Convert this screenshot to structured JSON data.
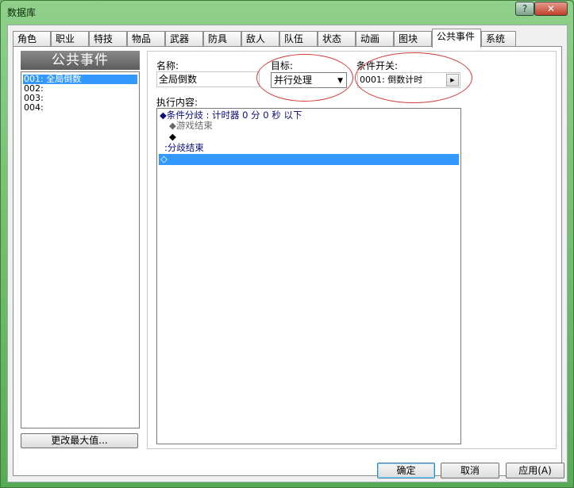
{
  "window": {
    "title": "数据库",
    "help_label": "?",
    "close_label": "✕"
  },
  "tabs": [
    {
      "label": "角色"
    },
    {
      "label": "职业"
    },
    {
      "label": "特技"
    },
    {
      "label": "物品"
    },
    {
      "label": "武器"
    },
    {
      "label": "防具"
    },
    {
      "label": "敌人"
    },
    {
      "label": "队伍"
    },
    {
      "label": "状态"
    },
    {
      "label": "动画"
    },
    {
      "label": "图块"
    },
    {
      "label": "公共事件"
    },
    {
      "label": "系统"
    }
  ],
  "active_tab": "公共事件",
  "sidebar": {
    "header": "公共事件",
    "items": [
      {
        "label": "001: 全局倒数"
      },
      {
        "label": "002:"
      },
      {
        "label": "003:"
      },
      {
        "label": "004:"
      }
    ],
    "change_max_label": "更改最大值..."
  },
  "form": {
    "name_label": "名称:",
    "name_value": "全局倒数",
    "target_label": "目标:",
    "target_value": "并行处理",
    "switch_label": "条件开关:",
    "switch_value": "0001: 倒数计时",
    "content_label": "执行内容:"
  },
  "commands": [
    {
      "text": "◆条件分歧 : 计时器 0 分 0 秒 以下"
    },
    {
      "text": "◆游戏结束"
    },
    {
      "text": "◆"
    },
    {
      "text": ":分歧结束"
    },
    {
      "text": "◇"
    }
  ],
  "buttons": {
    "ok": "确定",
    "cancel": "取消",
    "apply": "应用(A)"
  },
  "colors": {
    "selection": "#3399ff",
    "annotation_oval": "#d23a3a",
    "command_text": "#0a0a7a"
  }
}
